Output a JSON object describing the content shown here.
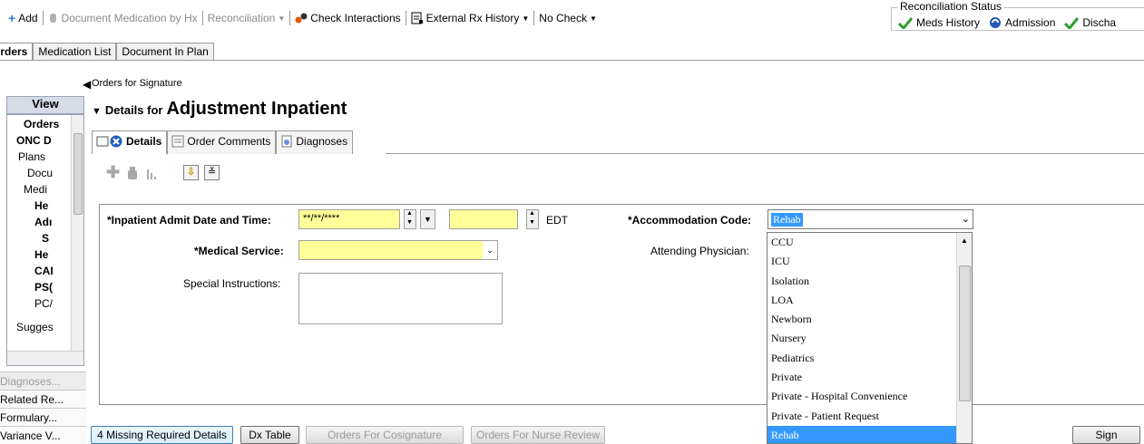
{
  "toolbar": {
    "add_label": "Add",
    "document_med_label": "Document Medication by Hx",
    "reconciliation_label": "Reconciliation",
    "check_interactions_label": "Check Interactions",
    "external_rx_label": "External Rx History",
    "no_check_label": "No Check"
  },
  "reconciliation_status": {
    "title": "Reconciliation Status",
    "items": [
      "Meds History",
      "Admission",
      "Discha"
    ]
  },
  "main_tabs": {
    "orders": "Orders",
    "medication_list": "Medication List",
    "document_in_plan": "Document In Plan"
  },
  "view_panel": {
    "header": "View",
    "tree": [
      {
        "label": "Orders",
        "bold": true
      },
      {
        "label": "ONC D",
        "bold": true
      },
      {
        "label": "Plans",
        "bold": false
      },
      {
        "label": "Docu",
        "bold": false
      },
      {
        "label": "Medi",
        "bold": false
      },
      {
        "label": "He",
        "bold": true
      },
      {
        "label": "Adı",
        "bold": true
      },
      {
        "label": "S",
        "bold": true
      },
      {
        "label": "He",
        "bold": true
      },
      {
        "label": "CAI",
        "bold": true
      },
      {
        "label": "PS(",
        "bold": true
      },
      {
        "label": "PC/",
        "bold": false
      },
      {
        "label": "Sugges",
        "bold": false
      }
    ],
    "links": [
      "Diagnoses...",
      "Related Re...",
      "Formulary...",
      "Variance V..."
    ]
  },
  "orders_for_signature": "Orders for Signature",
  "details": {
    "prefix": "Details for",
    "title": "Adjustment Inpatient"
  },
  "sub_tabs": {
    "details": "Details",
    "order_comments": "Order Comments",
    "diagnoses": "Diagnoses"
  },
  "form": {
    "admit_label": "*Inpatient Admit Date and Time:",
    "admit_date_value": "**/**/****",
    "timezone": "EDT",
    "medical_service_label": "*Medical Service:",
    "special_instructions_label": "Special Instructions:",
    "accommodation_label": "*Accommodation Code:",
    "accommodation_value": "Rehab",
    "attending_label": "Attending Physician:"
  },
  "accommodation_options": [
    "CCU",
    "ICU",
    "Isolation",
    "LOA",
    "Newborn",
    "Nursery",
    "Pediatrics",
    "Private",
    "Private - Hospital Convenience",
    "Private - Patient Request",
    "Rehab"
  ],
  "bottom_buttons": {
    "missing": "4 Missing Required Details",
    "dx_table": "Dx Table",
    "cosign": "Orders For Cosignature",
    "nurse_review": "Orders For Nurse Review",
    "sign": "Sign"
  },
  "colors": {
    "required_field": "#ffff99",
    "selection": "#3399ff",
    "check_green": "#2e9e2e"
  }
}
